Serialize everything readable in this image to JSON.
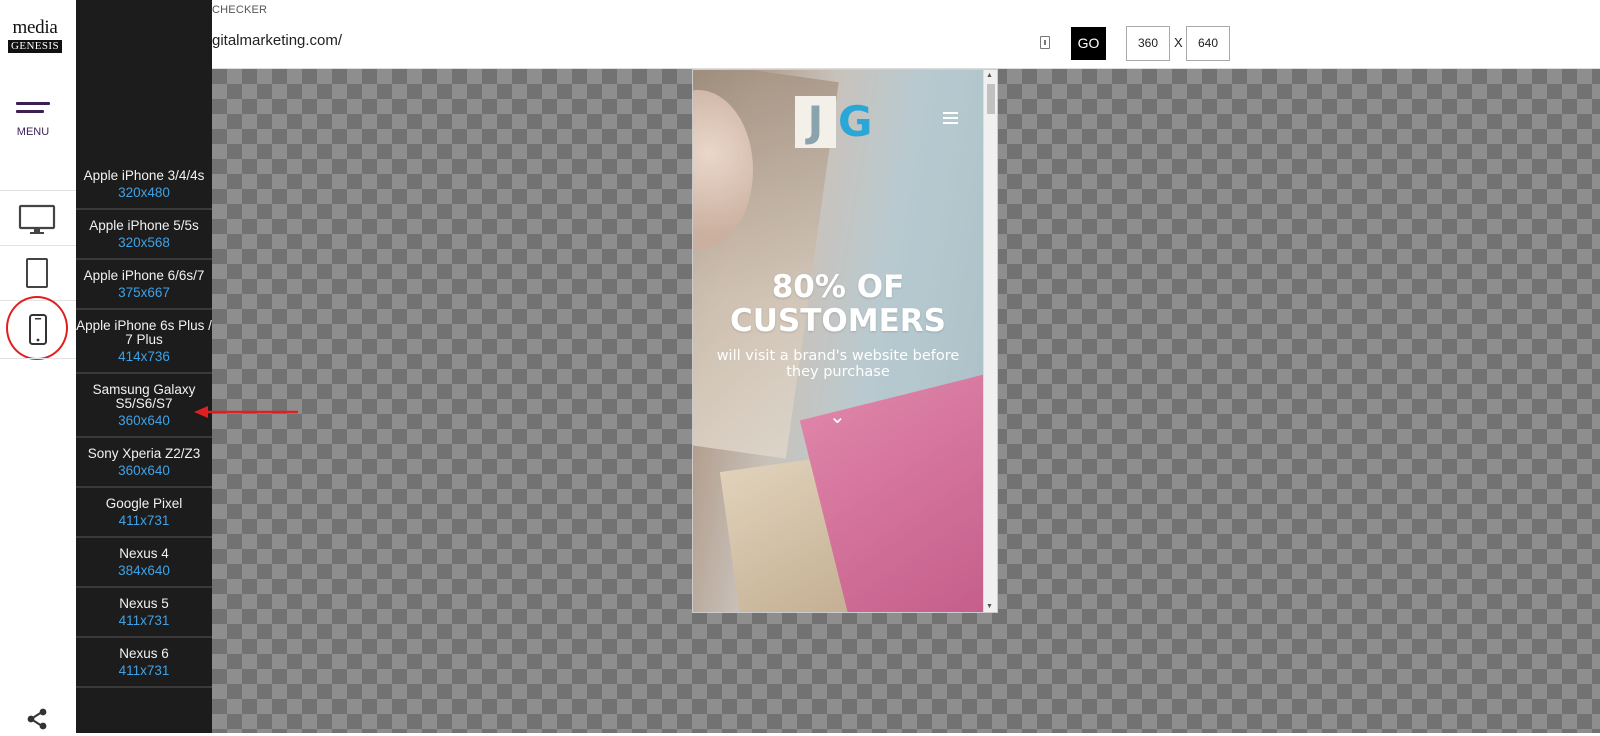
{
  "brand": {
    "line1": "media",
    "line2": "GENESIS"
  },
  "rail": {
    "menu_label": "MENU"
  },
  "topbar": {
    "app_title": "CHECKER",
    "url_text": "gitalmarketing.com/",
    "go_label": "GO",
    "width_value": "360",
    "x_label": "X",
    "height_value": "640"
  },
  "devices": [
    {
      "name": "Apple iPhone 3/4/4s",
      "res": "320x480"
    },
    {
      "name": "Apple iPhone 5/5s",
      "res": "320x568"
    },
    {
      "name": "Apple iPhone 6/6s/7",
      "res": "375x667"
    },
    {
      "name": "Apple iPhone 6s Plus / 7 Plus",
      "res": "414x736"
    },
    {
      "name": "Samsung Galaxy S5/S6/S7",
      "res": "360x640"
    },
    {
      "name": "Sony Xperia Z2/Z3",
      "res": "360x640"
    },
    {
      "name": "Google Pixel",
      "res": "411x731"
    },
    {
      "name": "Nexus 4",
      "res": "384x640"
    },
    {
      "name": "Nexus 5",
      "res": "411x731"
    },
    {
      "name": "Nexus 6",
      "res": "411x731"
    }
  ],
  "preview": {
    "logo_j": "J",
    "logo_g": "G",
    "headline_1": "80% OF",
    "headline_2": "CUSTOMERS",
    "subtext": "will visit a brand's website before they purchase",
    "scroll_chevron": "⌄"
  },
  "colors": {
    "accent_blue": "#3fa2e6",
    "annotation_red": "#e02020",
    "menu_purple": "#3b1f55",
    "go_black": "#000000"
  },
  "icons": {
    "desktop": "desktop-icon",
    "tablet": "tablet-icon",
    "mobile": "mobile-icon",
    "share": "share-icon",
    "menu": "hamburger-icon"
  }
}
